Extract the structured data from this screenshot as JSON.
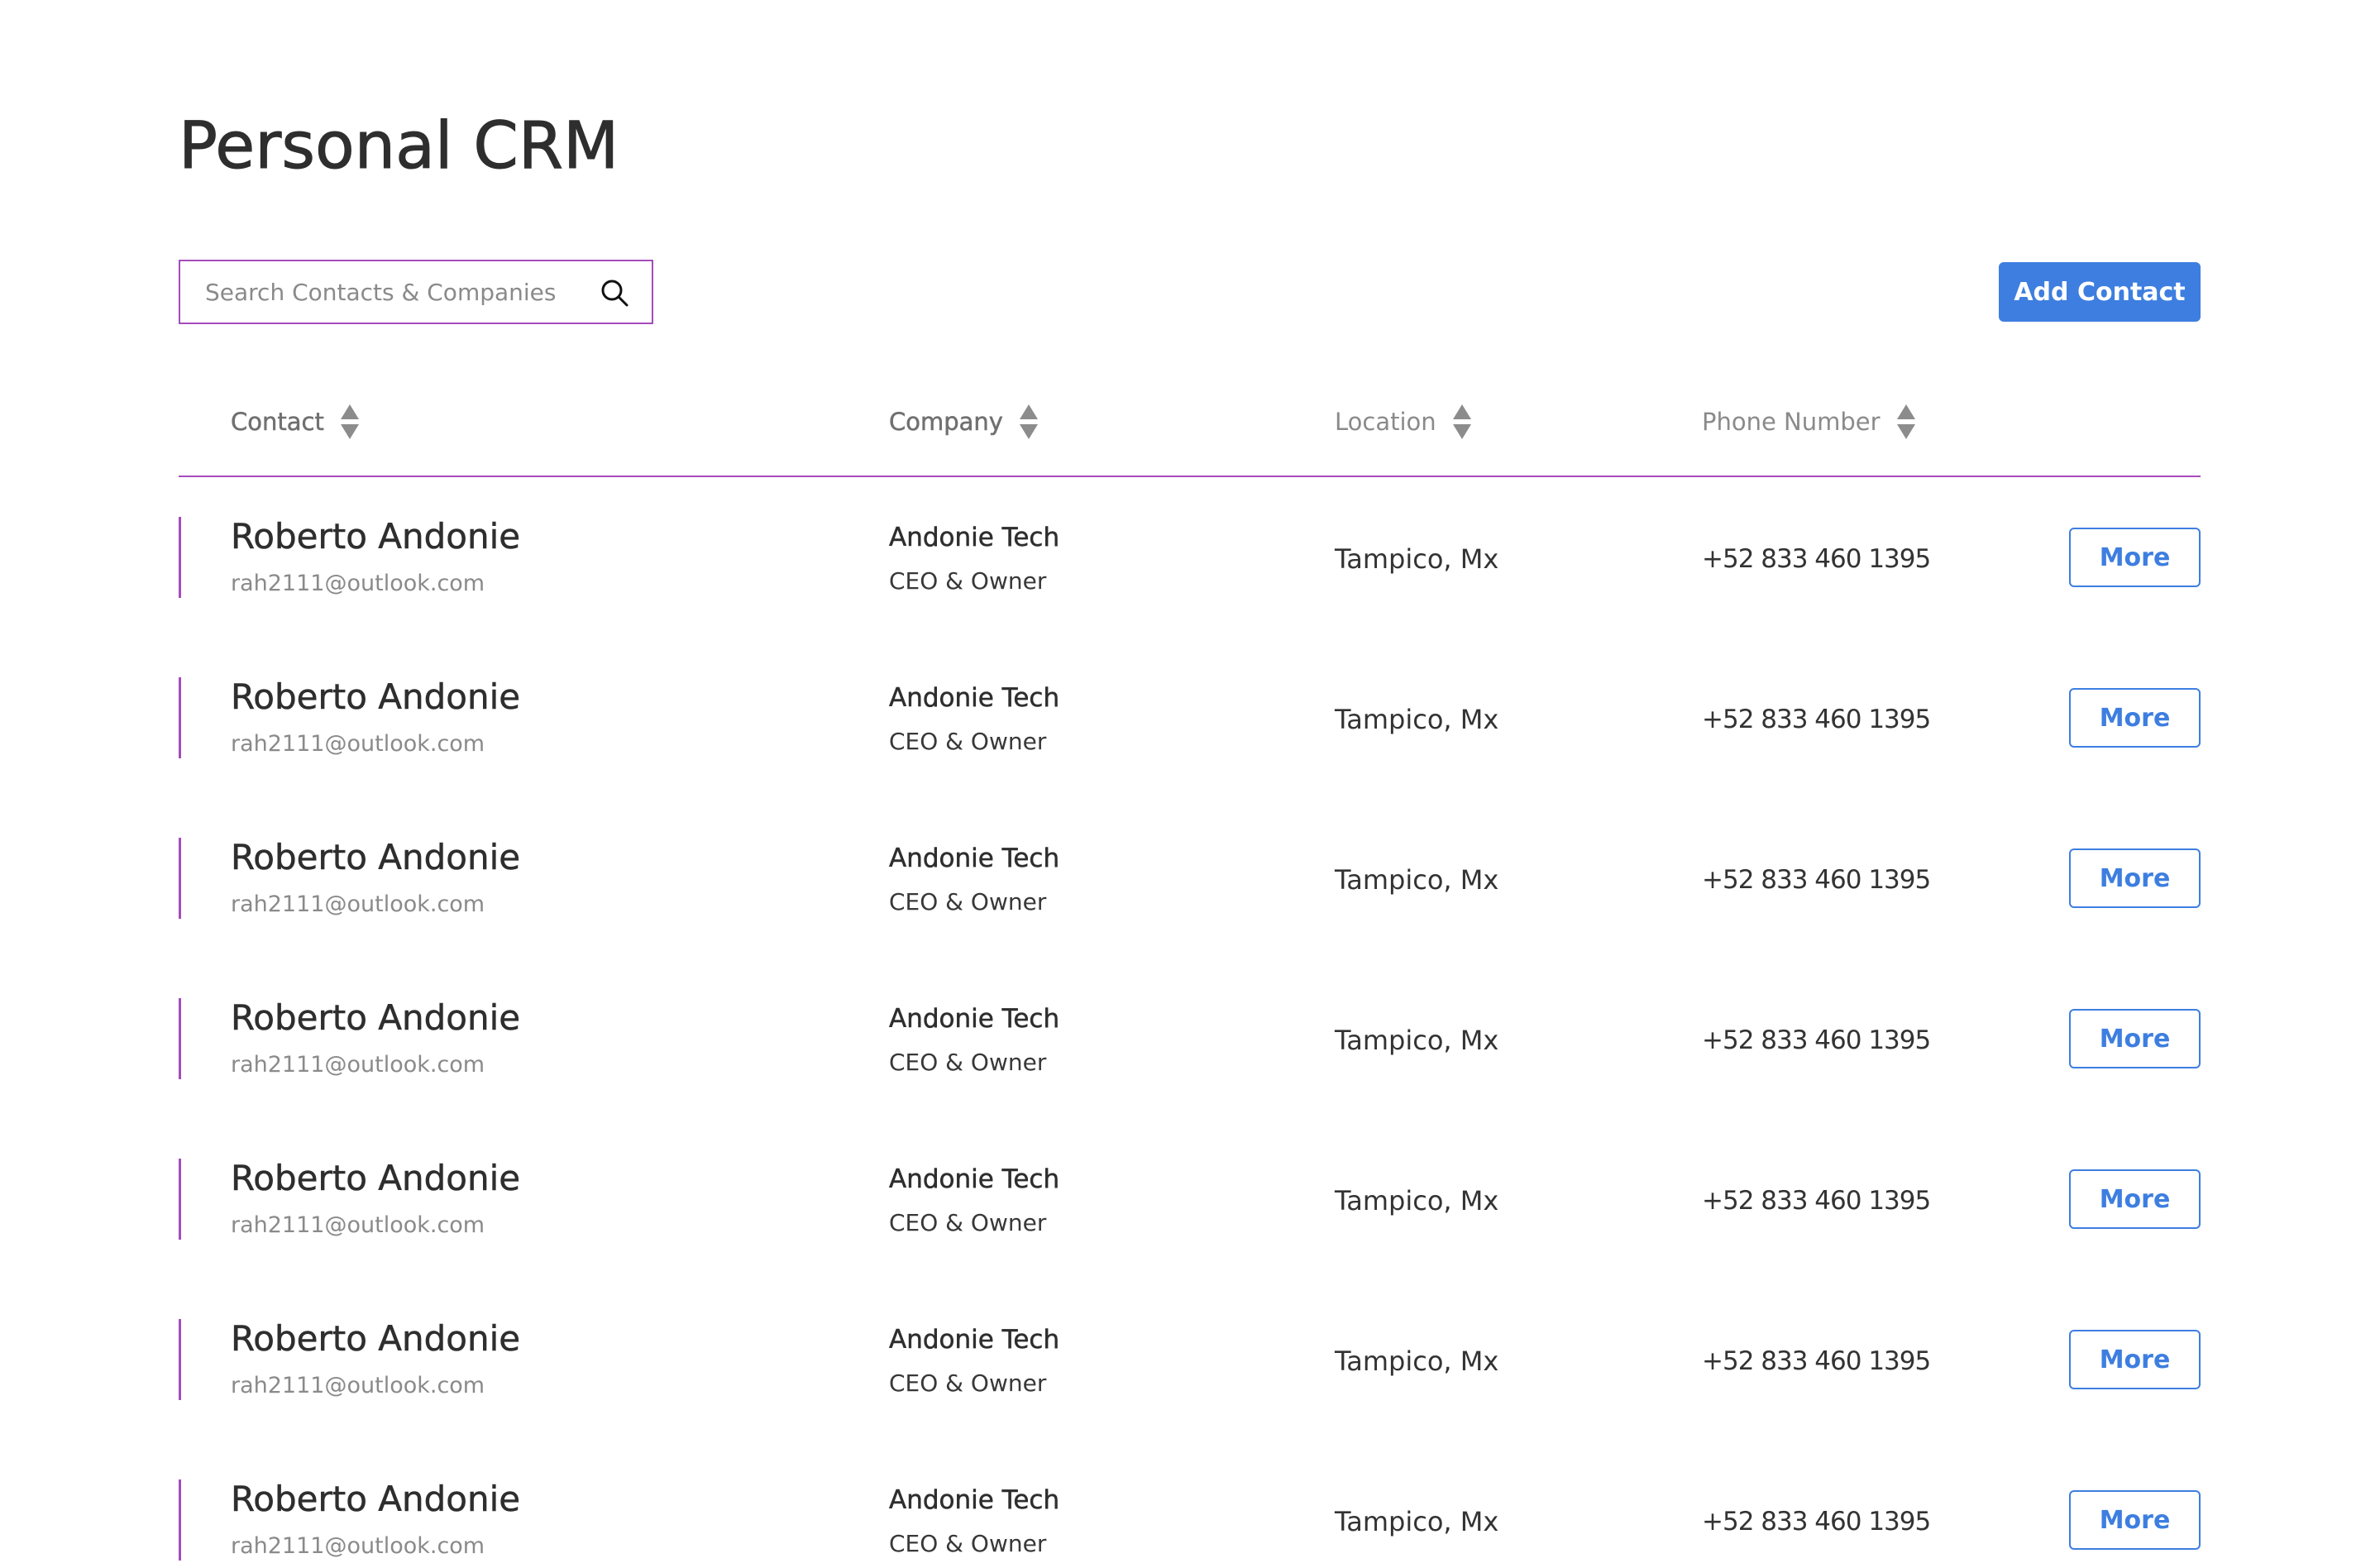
{
  "app": {
    "title": "Personal CRM"
  },
  "search": {
    "placeholder": "Search Contacts & Companies",
    "icon": "search-icon"
  },
  "toolbar": {
    "add_contact_label": "Add Contact"
  },
  "table": {
    "sort_icon": "sort-icon",
    "columns": [
      {
        "label": "Contact"
      },
      {
        "label": "Company"
      },
      {
        "label": "Location"
      },
      {
        "label": "Phone Number"
      }
    ],
    "rows": [
      {
        "name": "Roberto Andonie",
        "email": "rah2111@outlook.com",
        "company": "Andonie Tech",
        "role": "CEO & Owner",
        "location": "Tampico, Mx",
        "phone": "+52 833 460 1395",
        "action_label": "More"
      },
      {
        "name": "Roberto Andonie",
        "email": "rah2111@outlook.com",
        "company": "Andonie Tech",
        "role": "CEO & Owner",
        "location": "Tampico, Mx",
        "phone": "+52 833 460 1395",
        "action_label": "More"
      },
      {
        "name": "Roberto Andonie",
        "email": "rah2111@outlook.com",
        "company": "Andonie Tech",
        "role": "CEO & Owner",
        "location": "Tampico, Mx",
        "phone": "+52 833 460 1395",
        "action_label": "More"
      },
      {
        "name": "Roberto Andonie",
        "email": "rah2111@outlook.com",
        "company": "Andonie Tech",
        "role": "CEO & Owner",
        "location": "Tampico, Mx",
        "phone": "+52 833 460 1395",
        "action_label": "More"
      },
      {
        "name": "Roberto Andonie",
        "email": "rah2111@outlook.com",
        "company": "Andonie Tech",
        "role": "CEO & Owner",
        "location": "Tampico, Mx",
        "phone": "+52 833 460 1395",
        "action_label": "More"
      },
      {
        "name": "Roberto Andonie",
        "email": "rah2111@outlook.com",
        "company": "Andonie Tech",
        "role": "CEO & Owner",
        "location": "Tampico, Mx",
        "phone": "+52 833 460 1395",
        "action_label": "More"
      },
      {
        "name": "Roberto Andonie",
        "email": "rah2111@outlook.com",
        "company": "Andonie Tech",
        "role": "CEO & Owner",
        "location": "Tampico, Mx",
        "phone": "+52 833 460 1395",
        "action_label": "More"
      }
    ]
  },
  "colors": {
    "accent": "#a64bbd",
    "primary": "#3d7ee0",
    "text": "#2e2e2e",
    "muted": "#8a8a8a"
  }
}
